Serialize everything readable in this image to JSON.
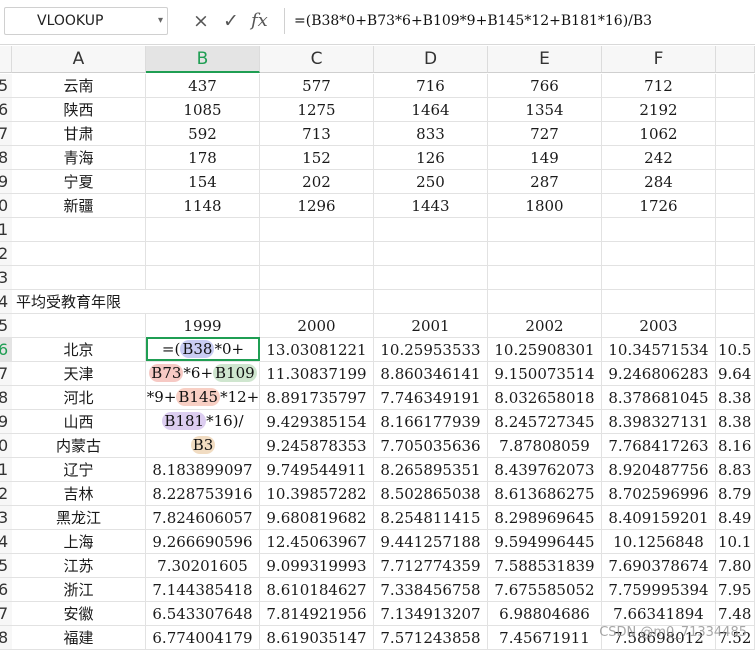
{
  "formula_bar": {
    "name_box": "VLOOKUP",
    "cancel_icon": "×",
    "confirm_icon": "✓",
    "fx_label": "fx",
    "formula": "=(B38*0+B73*6+B109*9+B145*12+B181*16)/B3"
  },
  "columns": [
    "A",
    "B",
    "C",
    "D",
    "E",
    "F"
  ],
  "rows": [
    {
      "num": "5",
      "cells": [
        "云南",
        "437",
        "577",
        "716",
        "766",
        "712"
      ]
    },
    {
      "num": "6",
      "cells": [
        "陕西",
        "1085",
        "1275",
        "1464",
        "1354",
        "2192"
      ]
    },
    {
      "num": "7",
      "cells": [
        "甘肃",
        "592",
        "713",
        "833",
        "727",
        "1062"
      ]
    },
    {
      "num": "8",
      "cells": [
        "青海",
        "178",
        "152",
        "126",
        "149",
        "242"
      ]
    },
    {
      "num": "9",
      "cells": [
        "宁夏",
        "154",
        "202",
        "250",
        "287",
        "284"
      ]
    },
    {
      "num": "0",
      "cells": [
        "新疆",
        "1148",
        "1296",
        "1443",
        "1800",
        "1726"
      ]
    },
    {
      "num": "1",
      "cells": [
        "",
        "",
        "",
        "",
        "",
        ""
      ]
    },
    {
      "num": "2",
      "cells": [
        "",
        "",
        "",
        "",
        "",
        ""
      ]
    },
    {
      "num": "3",
      "cells": [
        "",
        "",
        "",
        "",
        "",
        ""
      ]
    },
    {
      "num": "4",
      "cells": [
        "平均受教育年限",
        "",
        "",
        "",
        "",
        ""
      ]
    },
    {
      "num": "5",
      "cells": [
        "",
        "1999",
        "2000",
        "2001",
        "2002",
        "2003"
      ]
    },
    {
      "num": "6",
      "cells": [
        "北京",
        "",
        "13.03081221",
        "10.25953533",
        "10.25908301",
        "10.34571534"
      ],
      "g": "10.5"
    },
    {
      "num": "7",
      "cells": [
        "天津",
        "",
        "11.30837199",
        "8.860346141",
        "9.150073514",
        "9.246806283"
      ],
      "g": "9.64"
    },
    {
      "num": "8",
      "cells": [
        "河北",
        "",
        "8.891735797",
        "7.746349191",
        "8.032658018",
        "8.378681045"
      ],
      "g": "8.38"
    },
    {
      "num": "9",
      "cells": [
        "山西",
        "",
        "9.429385154",
        "8.166177939",
        "8.245727345",
        "8.398327131"
      ],
      "g": "8.38"
    },
    {
      "num": "0",
      "cells": [
        "内蒙古",
        "",
        "9.245878353",
        "7.705035636",
        "7.87808059",
        "7.768417263"
      ],
      "g": "8.16"
    },
    {
      "num": "1",
      "cells": [
        "辽宁",
        "8.183899097",
        "9.749544911",
        "8.265895351",
        "8.439762073",
        "8.920487756"
      ],
      "g": "8.83"
    },
    {
      "num": "2",
      "cells": [
        "吉林",
        "8.228753916",
        "10.39857282",
        "8.502865038",
        "8.613686275",
        "8.702596996"
      ],
      "g": "8.79"
    },
    {
      "num": "3",
      "cells": [
        "黑龙江",
        "7.824606057",
        "9.680819682",
        "8.254811415",
        "8.298969645",
        "8.409159201"
      ],
      "g": "8.49"
    },
    {
      "num": "4",
      "cells": [
        "上海",
        "9.266690596",
        "12.45063967",
        "9.441257188",
        "9.594996445",
        "10.1256848"
      ],
      "g": "10.1"
    },
    {
      "num": "5",
      "cells": [
        "江苏",
        "7.30201605",
        "9.099319993",
        "7.712774359",
        "7.588531839",
        "7.690378674"
      ],
      "g": "7.80"
    },
    {
      "num": "6",
      "cells": [
        "浙江",
        "7.144385418",
        "8.610184627",
        "7.338456758",
        "7.675585052",
        "7.759995394"
      ],
      "g": "7.95"
    },
    {
      "num": "7",
      "cells": [
        "安徽",
        "6.543307648",
        "7.814921956",
        "7.134913207",
        "6.98804686",
        "7.66341894"
      ],
      "g": "7.48"
    },
    {
      "num": "8",
      "cells": [
        "福建",
        "6.774004179",
        "8.619035147",
        "7.571243858",
        "7.45671911",
        "7.58698012"
      ],
      "g": "7.52"
    }
  ],
  "editing_cell": {
    "line1_pre": "=(",
    "ref1": "B38",
    "line1_post": "*0+",
    "ref2": "B73",
    "mid2": "*6+",
    "ref3": "B109",
    "pre3": "*9+",
    "ref4": "B145",
    "post3": "*12+",
    "ref5": "B181",
    "post4": "*16)/",
    "ref6": "B3"
  },
  "watermark": "CSDN @m0_71334485"
}
